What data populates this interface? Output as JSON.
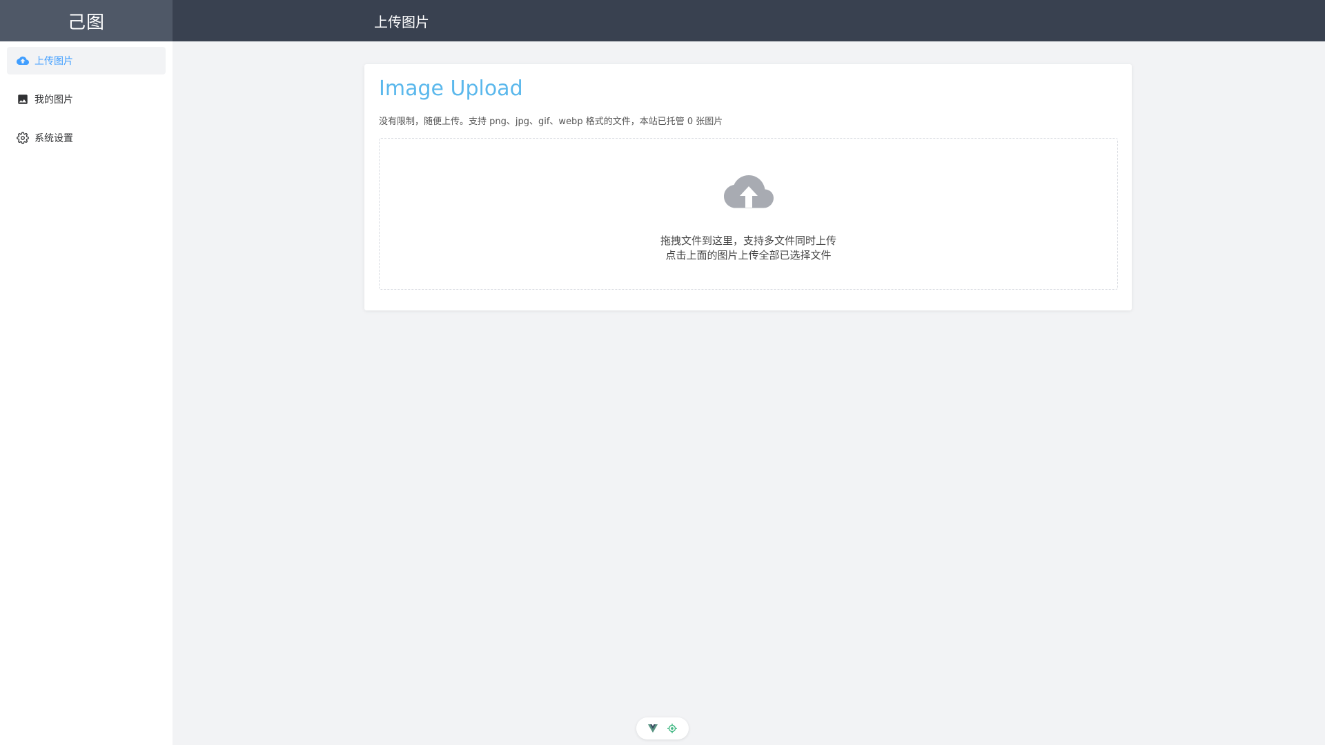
{
  "brand": {
    "name": "己图"
  },
  "header": {
    "title": "上传图片"
  },
  "sidebar": {
    "items": [
      {
        "label": "上传图片",
        "icon": "cloud-upload-icon",
        "active": true
      },
      {
        "label": "我的图片",
        "icon": "image-icon",
        "active": false
      },
      {
        "label": "系统设置",
        "icon": "gear-icon",
        "active": false
      }
    ]
  },
  "upload": {
    "title": "Image Upload",
    "description": "没有限制，随便上传。支持 png、jpg、gif、webp 格式的文件，本站已托管 0 张图片",
    "drop_line1": "拖拽文件到这里，支持多文件同时上传",
    "drop_line2": "点击上面的图片上传全部已选择文件",
    "icon": "cloud-upload-icon"
  },
  "mini_bar": {
    "icons": [
      "vue-devtools-icon",
      "inspector-target-icon"
    ]
  },
  "colors": {
    "accent": "#409eff",
    "title_blue": "#5bb8ec",
    "header_bg": "#394150",
    "brand_bg": "#4f5867",
    "page_bg": "#f2f3f5",
    "cloud_gray": "#a8abb2"
  }
}
